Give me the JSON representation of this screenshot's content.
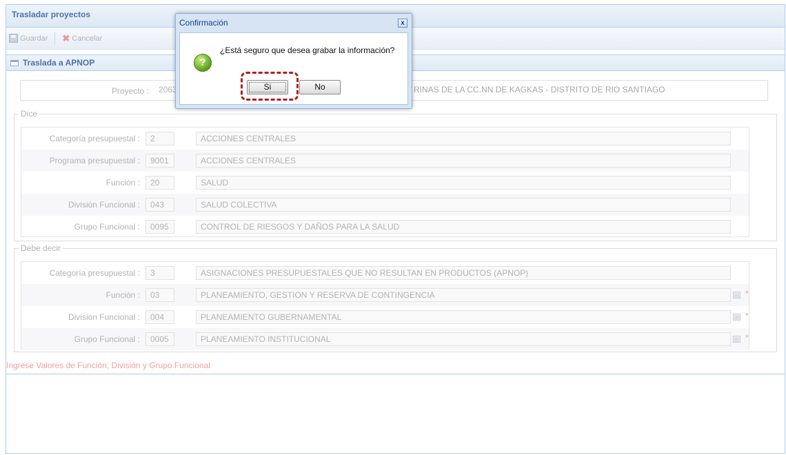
{
  "window": {
    "title": "Trasladar proyectos"
  },
  "toolbar": {
    "save_label": "Guardar",
    "cancel_label": "Cancelar"
  },
  "panel": {
    "title": "Traslada a APNOP"
  },
  "project": {
    "label": "Proyecto :",
    "code_visible": "206386",
    "description_visible": "RINAS DE LA CC.NN DE KAGKAS - DISTRITO DE RIO SANTIAGO"
  },
  "dice": {
    "legend": "Dice",
    "rows": [
      {
        "label": "Categoría presupuestal :",
        "code": "2",
        "desc": "ACCIONES CENTRALES"
      },
      {
        "label": "Programa presupuestal :",
        "code": "9001",
        "desc": "ACCIONES CENTRALES"
      },
      {
        "label": "Función :",
        "code": "20",
        "desc": "SALUD"
      },
      {
        "label": "División Funcional :",
        "code": "043",
        "desc": "SALUD COLECTIVA"
      },
      {
        "label": "Grupo Funcional :",
        "code": "0095",
        "desc": "CONTROL DE RIESGOS Y DAÑOS PARA LA SALUD"
      }
    ]
  },
  "debe_decir": {
    "legend": "Debe decir",
    "rows": [
      {
        "label": "Categoría presupuestal :",
        "code": "3",
        "desc": "ASIGNACIONES PRESUPUESTALES QUE NO RESULTAN EN PRODUCTOS (APNOP)"
      },
      {
        "label": "Función :",
        "code": "03",
        "desc": "PLANEAMIENTO, GESTION Y RESERVA DE CONTINGENCIA",
        "required": "*"
      },
      {
        "label": "División Funcional :",
        "code": "004",
        "desc": "PLANEAMIENTO GUBERNAMENTAL",
        "required": "*"
      },
      {
        "label": "Grupo Funcional :",
        "code": "0005",
        "desc": "PLANEAMIENTO INSTITUCIONAL",
        "required": "*"
      }
    ]
  },
  "hint": "Ingrese Valores de Función, División y Grupo Funcional",
  "dialog": {
    "title": "Confirmación",
    "close": "x",
    "icon": "?",
    "message": "¿Está seguro que desea grabar la información?",
    "yes_label": "Si",
    "no_label": "No"
  }
}
